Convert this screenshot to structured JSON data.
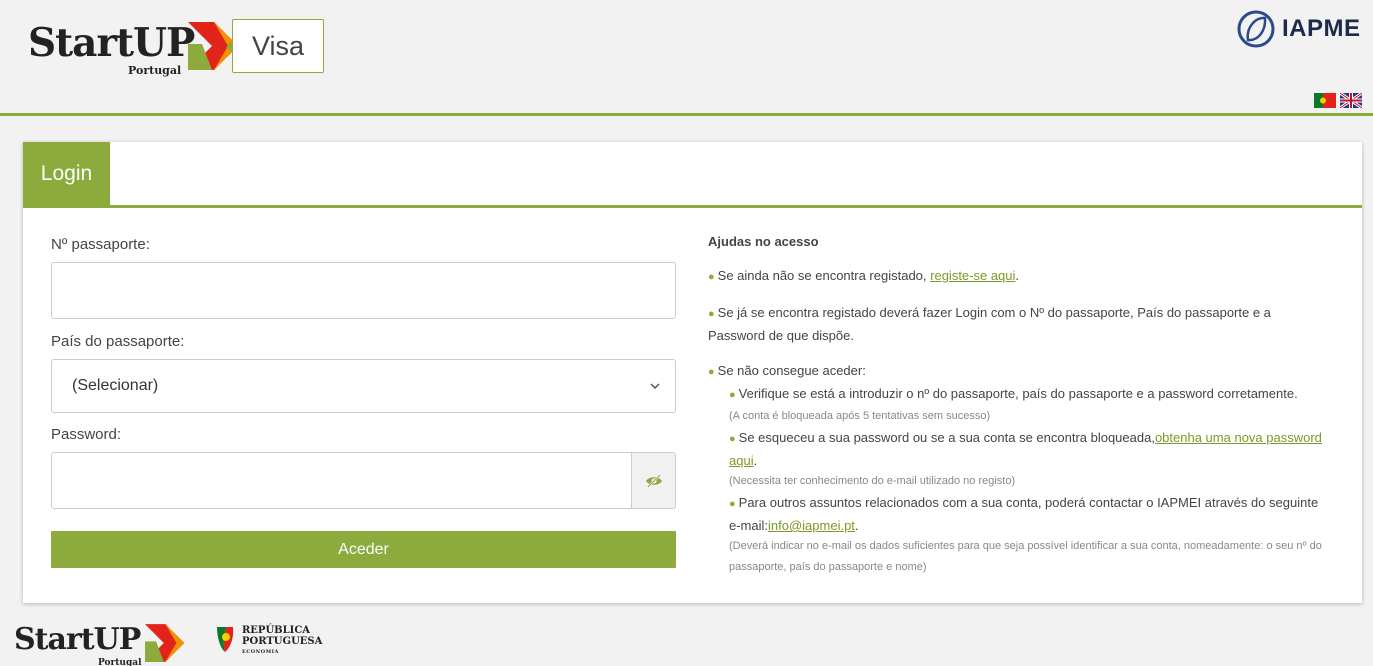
{
  "header": {
    "logo_word": "StartUP",
    "logo_sub": "Portugal",
    "visa_label": "Visa",
    "partner_name": "IAPME",
    "flags": [
      "pt-flag-icon",
      "uk-flag-icon"
    ]
  },
  "card": {
    "tab_label": "Login",
    "form": {
      "passport_label": "Nº passaporte:",
      "passport_value": "",
      "country_label": "País do passaporte:",
      "country_selected": "(Selecionar)",
      "password_label": "Password:",
      "password_value": "",
      "submit_label": "Aceder"
    },
    "help": {
      "title": "Ajudas no acesso",
      "item1_text": "Se ainda não se encontra registado, ",
      "item1_link": "registe-se aqui",
      "item1_end": ".",
      "item2_text": "Se já se encontra registado deverá fazer Login com o Nº do passaporte, País do passaporte e a Password de que dispõe.",
      "item3_text": "Se não consegue aceder:",
      "sub1_text": "Verifique se está a introduzir o nº do passaporte, país do passaporte e a password corretamente.",
      "sub1_note": "(A conta é bloqueada após 5 tentativas sem sucesso)",
      "sub2_text": "Se esqueceu a sua password ou se a sua conta se encontra bloqueada,",
      "sub2_link": "obtenha uma nova password aqui",
      "sub2_end": ".",
      "sub2_note": "(Necessita ter conhecimento do e-mail utilizado no registo)",
      "sub3_text": "Para outros assuntos relacionados com a sua conta, poderá contactar o IAPMEI através do seguinte e-mail:",
      "sub3_link": "info@iapmei.pt",
      "sub3_end": ".",
      "sub3_note": "(Deverá indicar no e-mail os dados suficientes para que seja possível identificar a sua conta, nomeadamente: o seu nº do passaporte, país do passaporte e nome)"
    }
  },
  "footer": {
    "logo_word": "StartUP",
    "logo_sub": "Portugal",
    "rep_line1": "REPÚBLICA",
    "rep_line2": "PORTUGUESA",
    "rep_line3": "ECONOMIA"
  },
  "colors": {
    "accent": "#8cab3c",
    "link": "#7a9a28"
  }
}
